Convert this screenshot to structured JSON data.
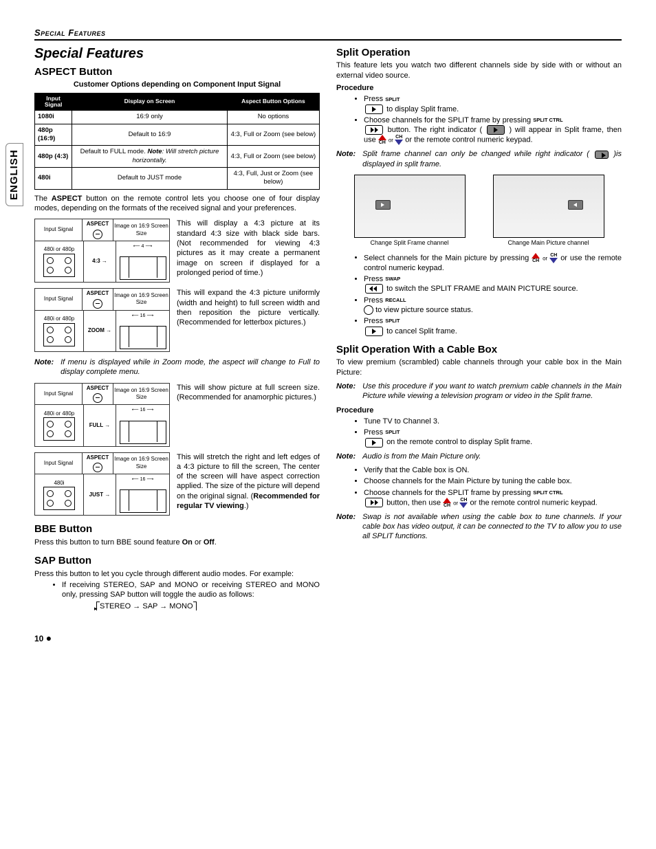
{
  "header": {
    "running": "Special Features"
  },
  "sideTab": "ENGLISH",
  "left": {
    "h1": "Special Features",
    "aspect": {
      "h2": "ASPECT Button",
      "subhead": "Customer Options depending on Component Input Signal",
      "table": {
        "head": [
          "Input Signal",
          "Display on Screen",
          "Aspect Button Options"
        ],
        "rows": [
          {
            "sig": "1080i",
            "disp": "16:9 only",
            "opt": "No options"
          },
          {
            "sig": "480p (16:9)",
            "disp": "Default to 16:9",
            "opt": "4:3, Full or Zoom (see below)"
          },
          {
            "sig": "480p (4:3)",
            "disp_html": "Default to FULL mode. <b><i>Note</i></b><i>: Will stretch picture horizontally.</i>",
            "opt": "4:3, Full or Zoom (see below)"
          },
          {
            "sig": "480i",
            "disp": "Default to JUST mode",
            "opt": "4:3, Full, Just or Zoom (see below)"
          }
        ]
      },
      "intro": "The <b>ASPECT</b> button on the remote control lets you choose one of four display modes, depending on the formats of the received signal and your preferences.",
      "modes": [
        {
          "sig": "480i or 480p",
          "label": "4:3 →",
          "headers": [
            "Input Signal",
            "ASPECT",
            "Image on 16:9 Screen Size"
          ],
          "dim": "4",
          "desc": "This will display a 4:3 picture at its standard 4:3 size with black side bars. (Not recommended for viewing 4:3 pictures as it  may create a permanent image on screen if displayed for a prolonged period of time.)"
        },
        {
          "sig": "480i  or 480p",
          "label": "ZOOM →",
          "headers": [
            "Input Signal",
            "ASPECT",
            "Image on 16:9 Screen Size"
          ],
          "dim": "16",
          "desc": "This will expand the 4:3 picture uniformly (width and height) to full screen width and then reposition the picture vertically. (Recommended for letterbox pictures.)"
        }
      ],
      "zoomNote": "If menu is displayed while in Zoom mode, the aspect will change to Full to display complete menu.",
      "modes2": [
        {
          "sig": "480i or 480p",
          "label": "FULL →",
          "headers": [
            "Input Signal",
            "ASPECT",
            "Image on 16:9 Screen Size"
          ],
          "dim": "16",
          "desc": "This will show picture at full screen size. (Recommended for anamorphic pictures.)"
        },
        {
          "sig": "480i",
          "label": "JUST →",
          "headers": [
            "Input Signal",
            "ASPECT",
            "Image on 16:9 Screen Size"
          ],
          "dim": "16",
          "desc": "This will stretch the right and left edges of a 4:3 picture to fill the screen, The center of the screen will have aspect correction applied. The size of the picture will depend on the original signal. (<b>Recommended for regular TV viewing</b>.)"
        }
      ]
    },
    "bbe": {
      "h2": "BBE Button",
      "text": "Press this button to turn BBE sound feature <b>On</b> or <b>Off</b>."
    },
    "sap": {
      "h2": "SAP Button",
      "text": "Press this button to let you cycle through different audio modes. For example:",
      "bullet": "If receiving STEREO, SAP and MONO or receiving STEREO and MONO only, pressing SAP button will toggle the audio as follows:",
      "cycle": [
        "STEREO",
        "SAP",
        "MONO"
      ]
    }
  },
  "right": {
    "split": {
      "h2": "Split Operation",
      "intro": "This feature lets you watch two different channels side by side with or without an external video source.",
      "procHead": "Procedure",
      "labels": {
        "split": "SPLIT",
        "splitCtrl": "SPLIT CTRL",
        "swap": "SWAP",
        "recall": "RECALL",
        "ch": "CH"
      },
      "steps": {
        "s1a": "Press ",
        "s1b": " to display Split frame.",
        "s2a": "Choose channels for the SPLIT frame by pressing ",
        "s2b": " button. The right indicator ( ",
        "s2c": " ) will appear in Split frame, then use ",
        "s2d": " or ",
        "s2e": " or the remote control numeric keypad."
      },
      "note1": "Split frame channel can only be changed while right indicator ( ",
      "note1b": " )is displayed in split frame.",
      "captions": {
        "left": "Change Split Frame channel",
        "right": "Change Main Picture channel"
      },
      "steps2": {
        "s3a": "Select channels for the Main picture by pressing ",
        "s3b": " or ",
        "s3c": " or use the remote control numeric keypad.",
        "s4a": "Press ",
        "s4b": " to switch the SPLIT FRAME and MAIN PICTURE source.",
        "s5a": "Press ",
        "s5b": " to view picture source status.",
        "s6a": "Press ",
        "s6b": " to cancel Split frame."
      }
    },
    "cable": {
      "h2": "Split Operation With a Cable Box",
      "intro": "To view premium (scrambled) cable channels through your cable box in the Main Picture:",
      "note1": "Use this procedure if you want to watch premium cable channels in the Main Picture while viewing a television program or video in the Split frame.",
      "procHead": "Procedure",
      "steps": {
        "s1": "Tune TV to Channel 3.",
        "s2a": "Press ",
        "s2b": " on the remote control to display Split frame."
      },
      "note2": "Audio is from the Main Picture only.",
      "steps2": {
        "s3": "Verify that the Cable box is ON.",
        "s4": "Choose channels for the Main Picture by tuning the cable box.",
        "s5a": "Choose channels for the SPLIT frame by pressing ",
        "s5b": " button, then use ",
        "s5c": " or ",
        "s5d": " or the remote control numeric keypad."
      },
      "note3": "Swap is not available when using the cable box to tune channels. If your cable box has video output, it can be connected to the TV to allow you to use all SPLIT functions."
    }
  },
  "pageNumber": "10"
}
